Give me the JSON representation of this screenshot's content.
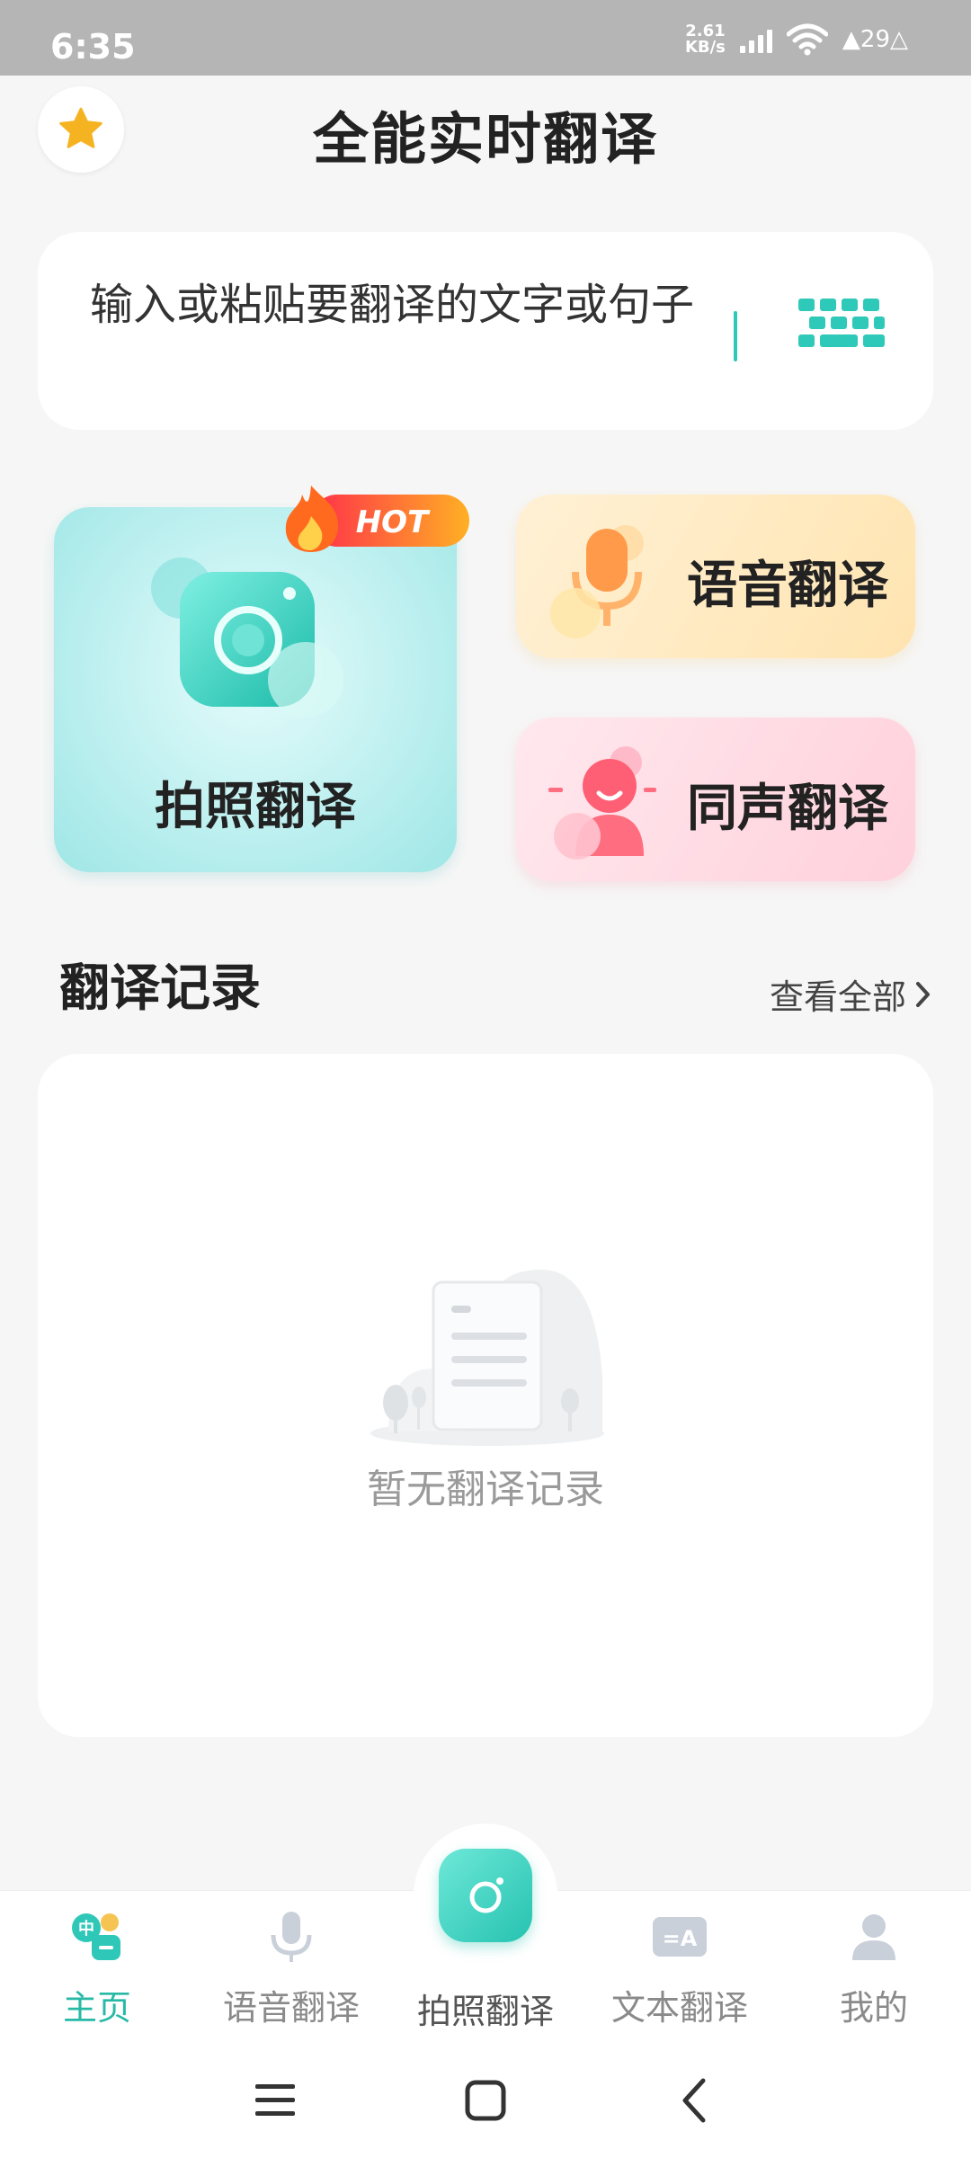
{
  "status_bar": {
    "time": "6:35",
    "net_speed_value": "2.61",
    "net_speed_unit": "KB/s",
    "extra_label": "29"
  },
  "header": {
    "title": "全能实时翻译",
    "favorite_icon": "star-icon"
  },
  "input": {
    "placeholder": "输入或粘贴要翻译的文字或句子",
    "keyboard_icon": "keyboard-icon"
  },
  "features": {
    "photo_label": "拍照翻译",
    "hot_badge": "HOT",
    "voice_label": "语音翻译",
    "sync_label": "同声翻译"
  },
  "records": {
    "title": "翻译记录",
    "view_all": "查看全部",
    "empty_text": "暂无翻译记录"
  },
  "bottom_nav": {
    "home": "主页",
    "voice": "语音翻译",
    "photo": "拍照翻译",
    "text": "文本翻译",
    "mine": "我的"
  },
  "colors": {
    "accent": "#27b9a6",
    "star": "#f6b321",
    "hot": "#f2462e"
  }
}
